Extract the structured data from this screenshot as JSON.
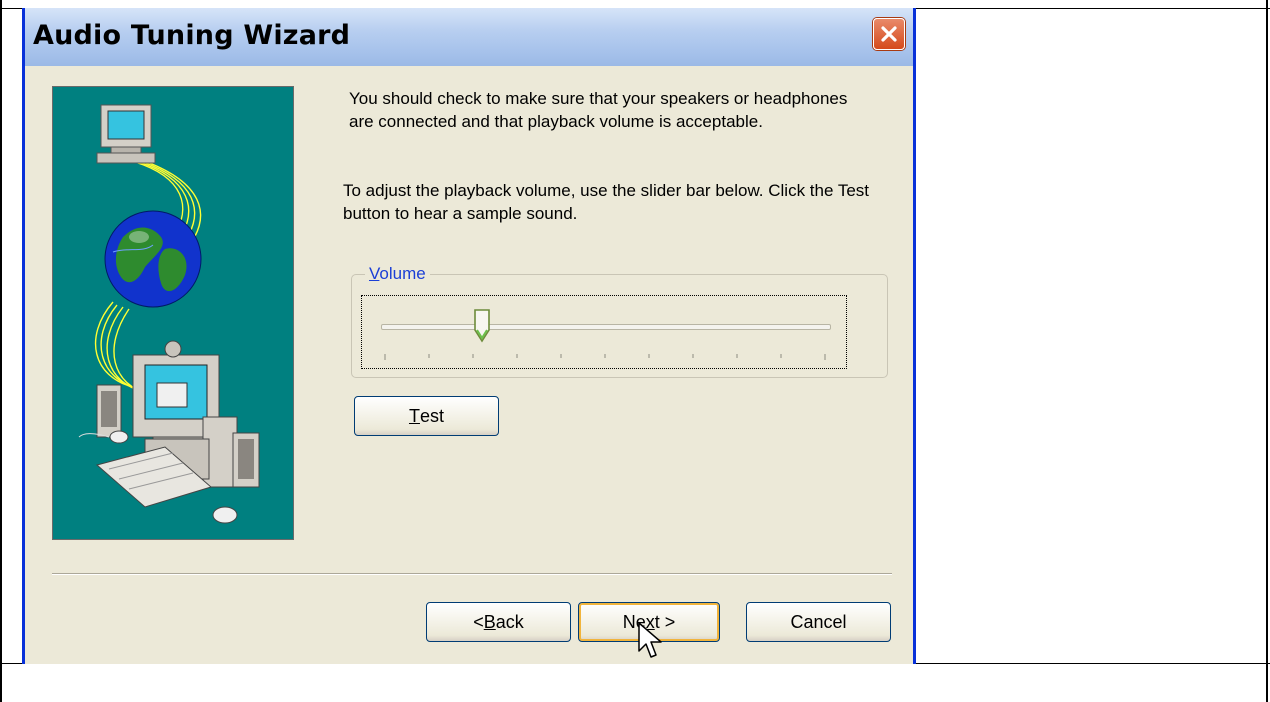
{
  "window": {
    "title": "Audio Tuning Wizard"
  },
  "instructions": {
    "line1": "You should check to make sure that your speakers or headphones are connected and that playback volume is acceptable.",
    "line2": "To adjust the playback volume, use the slider bar below.  Click the Test button to hear a sample sound."
  },
  "volume": {
    "group_label_mnemonic": "V",
    "group_label_rest": "olume",
    "level_fraction": 0.22,
    "tick_count": 11
  },
  "buttons": {
    "test": {
      "mnemonic": "T",
      "rest": "est"
    },
    "back": {
      "prefix": "< ",
      "mnemonic": "B",
      "rest": "ack"
    },
    "next": {
      "prefix": "Ne",
      "mnemonic": "x",
      "rest": "t >"
    },
    "cancel": "Cancel"
  },
  "colors": {
    "art_background": "#008080",
    "title_bar": "#b7cef0",
    "close_button": "#d54a1c",
    "group_label": "#1b3fd6"
  },
  "icons": [
    "close-icon",
    "computer-icon",
    "globe-icon",
    "workstation-icon",
    "mouse-icon",
    "keyboard-icon",
    "cursor-icon"
  ]
}
